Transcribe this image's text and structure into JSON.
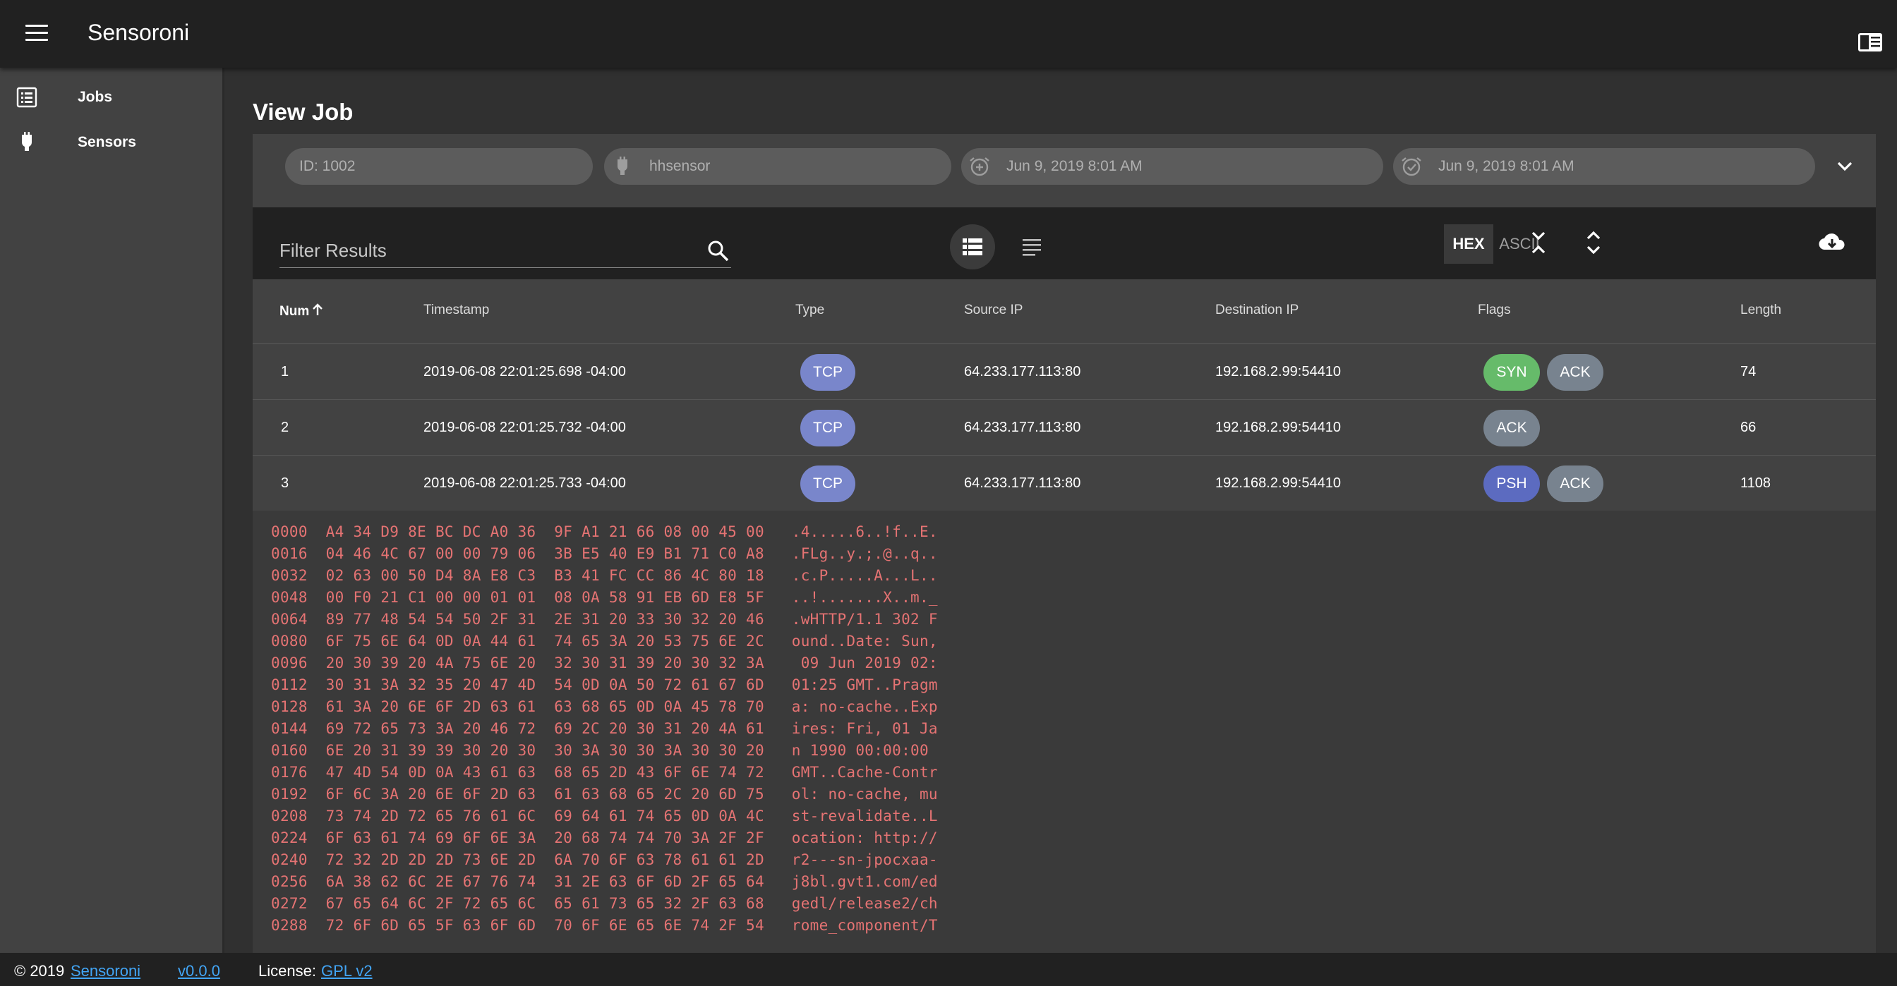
{
  "app": {
    "title": "Sensoroni"
  },
  "sidebar": {
    "items": [
      {
        "label": "Jobs",
        "icon": "list-icon"
      },
      {
        "label": "Sensors",
        "icon": "sensor-icon"
      }
    ]
  },
  "page": {
    "title": "View Job"
  },
  "criteria": {
    "id": "ID: 1002",
    "sensor": "hhsensor",
    "start_time": "Jun 9, 2019 8:01 AM",
    "end_time": "Jun 9, 2019 8:01 AM"
  },
  "toolbar": {
    "filter_placeholder": "Filter Results",
    "hex_label": "HEX",
    "ascii_label": "ASCII"
  },
  "table": {
    "columns": [
      "Num",
      "Timestamp",
      "Type",
      "Source IP",
      "Destination IP",
      "Flags",
      "Length"
    ],
    "rows": [
      {
        "num": "1",
        "timestamp": "2019-06-08 22:01:25.698 -04:00",
        "type": "TCP",
        "src": "64.233.177.113:80",
        "dst": "192.168.2.99:54410",
        "flags": [
          "SYN",
          "ACK"
        ],
        "length": "74"
      },
      {
        "num": "2",
        "timestamp": "2019-06-08 22:01:25.732 -04:00",
        "type": "TCP",
        "src": "64.233.177.113:80",
        "dst": "192.168.2.99:54410",
        "flags": [
          "ACK"
        ],
        "length": "66"
      },
      {
        "num": "3",
        "timestamp": "2019-06-08 22:01:25.733 -04:00",
        "type": "TCP",
        "src": "64.233.177.113:80",
        "dst": "192.168.2.99:54410",
        "flags": [
          "PSH",
          "ACK"
        ],
        "length": "1108"
      }
    ]
  },
  "colors": {
    "tcp": "#7986cb",
    "syn": "#66bb6a",
    "ack": "#78838f",
    "psh": "#5c6bc0",
    "hex_text": "#e57373",
    "link": "#42a5f5"
  },
  "hexdump": [
    "0000  A4 34 D9 8E BC DC A0 36  9F A1 21 66 08 00 45 00   .4.....6..!f..E.",
    "0016  04 46 4C 67 00 00 79 06  3B E5 40 E9 B1 71 C0 A8   .FLg..y.;.@..q..",
    "0032  02 63 00 50 D4 8A E8 C3  B3 41 FC CC 86 4C 80 18   .c.P.....A...L..",
    "0048  00 F0 21 C1 00 00 01 01  08 0A 58 91 EB 6D E8 5F   ..!.......X..m._",
    "0064  89 77 48 54 54 50 2F 31  2E 31 20 33 30 32 20 46   .wHTTP/1.1 302 F",
    "0080  6F 75 6E 64 0D 0A 44 61  74 65 3A 20 53 75 6E 2C   ound..Date: Sun,",
    "0096  20 30 39 20 4A 75 6E 20  32 30 31 39 20 30 32 3A    09 Jun 2019 02:",
    "0112  30 31 3A 32 35 20 47 4D  54 0D 0A 50 72 61 67 6D   01:25 GMT..Pragm",
    "0128  61 3A 20 6E 6F 2D 63 61  63 68 65 0D 0A 45 78 70   a: no-cache..Exp",
    "0144  69 72 65 73 3A 20 46 72  69 2C 20 30 31 20 4A 61   ires: Fri, 01 Ja",
    "0160  6E 20 31 39 39 30 20 30  30 3A 30 30 3A 30 30 20   n 1990 00:00:00 ",
    "0176  47 4D 54 0D 0A 43 61 63  68 65 2D 43 6F 6E 74 72   GMT..Cache-Contr",
    "0192  6F 6C 3A 20 6E 6F 2D 63  61 63 68 65 2C 20 6D 75   ol: no-cache, mu",
    "0208  73 74 2D 72 65 76 61 6C  69 64 61 74 65 0D 0A 4C   st-revalidate..L",
    "0224  6F 63 61 74 69 6F 6E 3A  20 68 74 74 70 3A 2F 2F   ocation: http://",
    "0240  72 32 2D 2D 2D 73 6E 2D  6A 70 6F 63 78 61 61 2D   r2---sn-jpocxaa-",
    "0256  6A 38 62 6C 2E 67 76 74  31 2E 63 6F 6D 2F 65 64   j8bl.gvt1.com/ed",
    "0272  67 65 64 6C 2F 72 65 6C  65 61 73 65 32 2F 63 68   gedl/release2/ch",
    "0288  72 6F 6D 65 5F 63 6F 6D  70 6F 6E 65 6E 74 2F 54   rome_component/T"
  ],
  "footer": {
    "copyright": "© 2019",
    "brand_link": "Sensoroni",
    "version_link": "v0.0.0",
    "license_label": "License:",
    "license_link": "GPL v2"
  }
}
